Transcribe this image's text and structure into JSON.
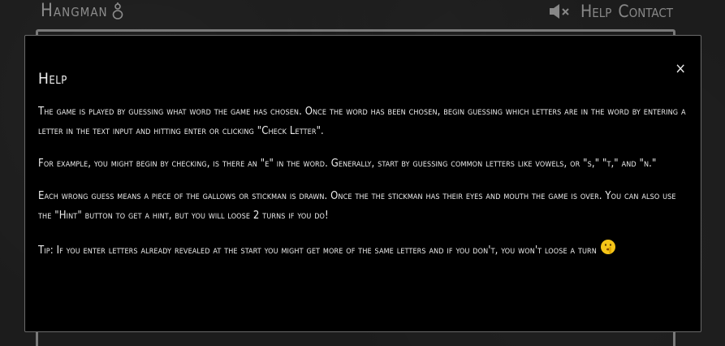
{
  "header": {
    "logo_text": "Hangman",
    "logo_icon": "stickman-icon",
    "sound_icon": "speaker-muted-icon",
    "nav": [
      "Help",
      "Contact"
    ]
  },
  "modal": {
    "title": "Help",
    "close_label": "×",
    "paragraphs": [
      "The game is played by guessing what word the game has chosen. Once the word has been chosen, begin guessing which letters are in the word by entering a letter in the text input and hitting enter or clicking \"Check Letter\".",
      "For example, you might begin by checking, is there an \"e\" in the word. Generally, start by guessing common letters like vowels, or \"s,\" \"t,\" and \"n.\"",
      "Each wrong guess means a piece of the gallows or stickman is drawn. Once the the stickman has their eyes and mouth the game is over. You can also use the \"Hint\" button to get a hint, but you will loose 2 turns if you do!",
      "Tip: If you enter letters already revealed at the start you might get more of the same letters and if you don't, you won't loose a turn"
    ],
    "tip_emoji": "shushing-face-icon"
  }
}
